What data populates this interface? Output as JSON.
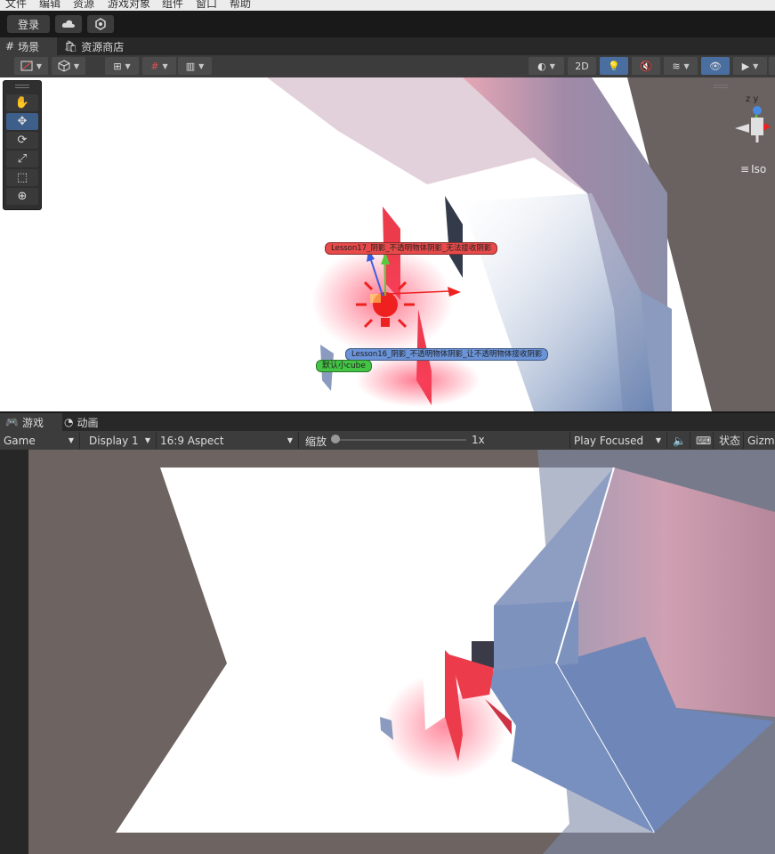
{
  "menu": [
    "文件",
    "编辑",
    "资源",
    "游戏对象",
    "组件",
    "窗口",
    "帮助"
  ],
  "toolbar": {
    "login": "登录",
    "cloud_icon": "cloud-icon",
    "settings_icon": "settings-icon"
  },
  "scene_tabs": [
    {
      "label": "场景",
      "icon": "grid-icon"
    },
    {
      "label": "资源商店",
      "icon": "store-icon"
    }
  ],
  "scene_toolbar": {
    "mode_2d": "2D",
    "iso_label": "Iso",
    "gizmo_axes": "z y"
  },
  "scene_labels": [
    {
      "text": "Lesson17_阴影_不透明物体阴影_无法接收阴影",
      "color": "#e84a4a"
    },
    {
      "text": "Lesson16_阴影_不透明物体阴影_让不透明物体接收阴影",
      "color": "#5b86d4"
    },
    {
      "text": "默认小cube",
      "color": "#44c444"
    }
  ],
  "tools": [
    "hand-tool",
    "move-tool",
    "rotate-tool",
    "scale-tool",
    "rect-tool",
    "transform-tool"
  ],
  "game_tabs": [
    {
      "label": "游戏",
      "icon": "gamepad-icon"
    },
    {
      "label": "动画",
      "icon": "clock-icon"
    }
  ],
  "game_toolbar": {
    "view": "Game",
    "display": "Display 1",
    "aspect": "16:9 Aspect",
    "scale_label": "缩放",
    "scale_value": "1x",
    "play_mode": "Play Focused",
    "stats": "状态",
    "gizmos": "Gizmo"
  }
}
